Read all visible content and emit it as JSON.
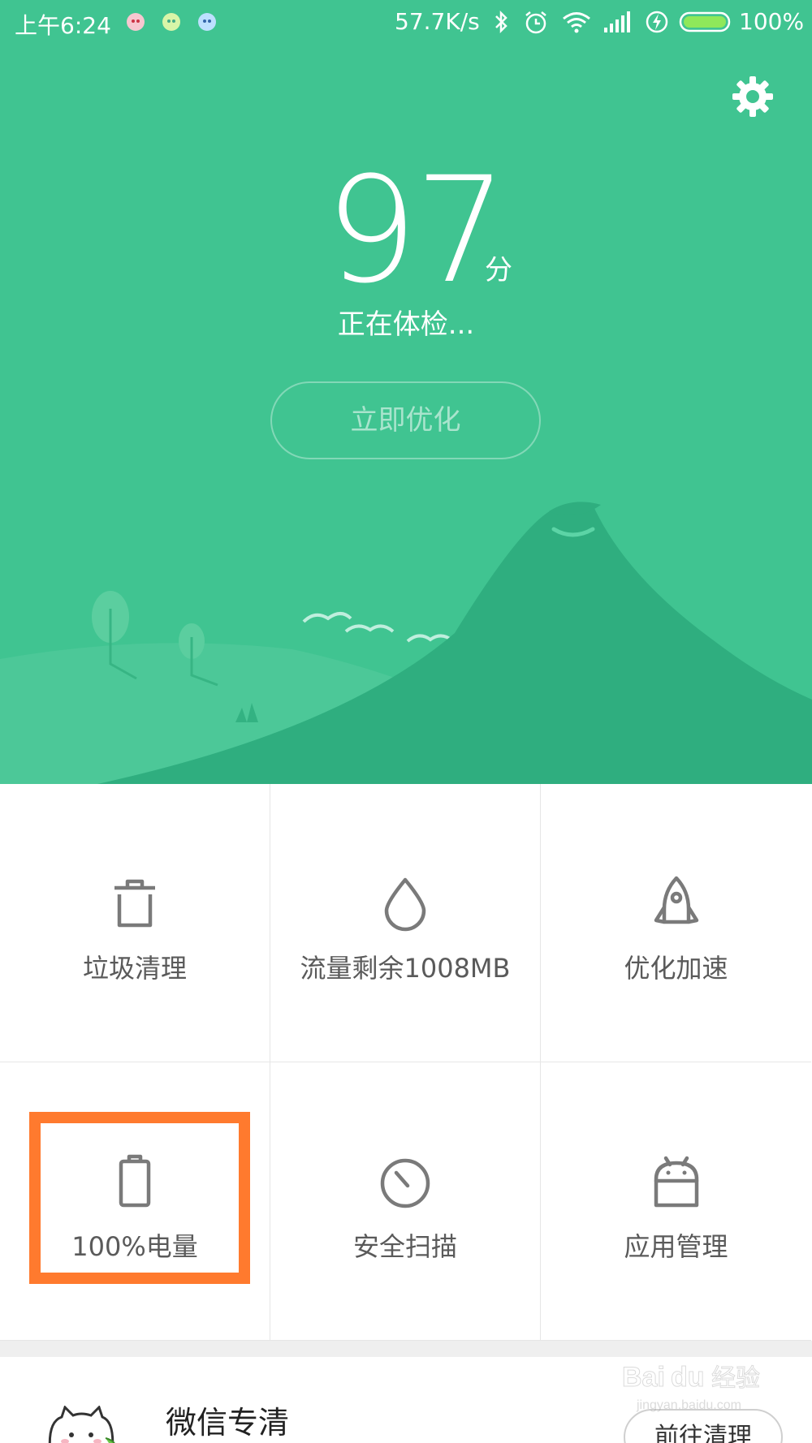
{
  "status_bar": {
    "time": "上午6:24",
    "net_speed": "57.7K/s",
    "battery_pct": "100%"
  },
  "hero": {
    "score": "97",
    "score_unit": "分",
    "status": "正在体检...",
    "optimize_label": "立即优化"
  },
  "features": [
    {
      "label": "垃圾清理",
      "icon": "trash-icon"
    },
    {
      "label": "流量剩余1008MB",
      "icon": "droplet-icon"
    },
    {
      "label": "优化加速",
      "icon": "rocket-icon"
    },
    {
      "label": "100%电量",
      "icon": "battery-icon"
    },
    {
      "label": "安全扫描",
      "icon": "scan-clock-icon"
    },
    {
      "label": "应用管理",
      "icon": "android-icon"
    }
  ],
  "wechat": {
    "title": "微信专清",
    "action_label": "前往清理"
  },
  "watermark": {
    "brand": "Baidu经验",
    "url": "jingyan.baidu.com"
  },
  "colors": {
    "primary_green": "#40c491",
    "hill_dark": "#2fae7f",
    "highlight": "#ff7a2e",
    "icon_gray": "#7a7a7a"
  }
}
